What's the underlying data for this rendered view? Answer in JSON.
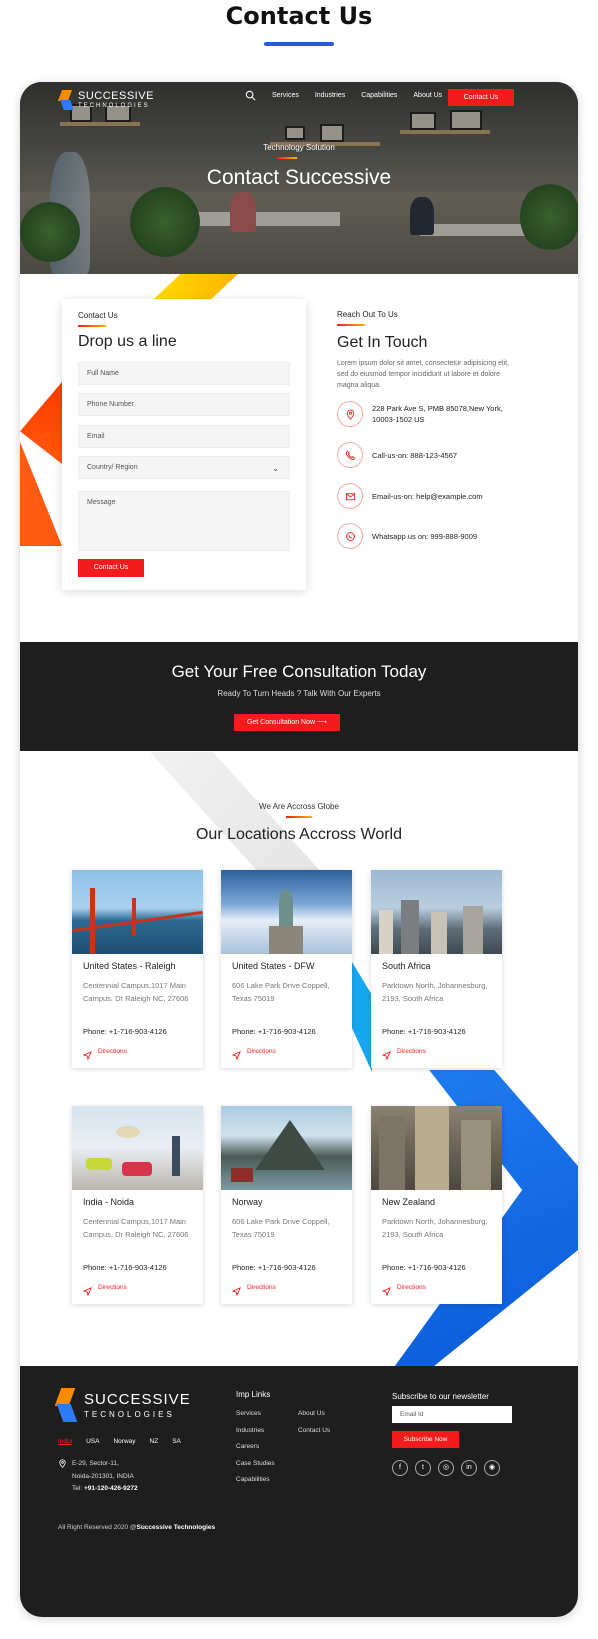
{
  "page_heading": "Contact Us",
  "header": {
    "logo_line1": "SUCCESSIVE",
    "logo_line2": "TECHNOLOGIES",
    "nav": [
      "Services",
      "Industries",
      "Capabilities",
      "About Us"
    ],
    "cta": "Contact Us"
  },
  "hero": {
    "eyebrow": "Technology Solution",
    "title": "Contact Successive"
  },
  "form": {
    "eyebrow": "Contact Us",
    "title": "Drop us a line",
    "full_name_placeholder": "Full Name",
    "phone_placeholder": "Phone Number",
    "email_placeholder": "Email",
    "country_placeholder": "Country/ Region",
    "message_placeholder": "Message",
    "submit": "Contact Us"
  },
  "contact_info": {
    "eyebrow": "Reach Out To Us",
    "title": "Get In Touch",
    "description": "Lorem ipsum dolor sit amet, consectetur adipisicing elit, sed do eiusmod tempor incididunt ut labore et dolore magna aliqua.",
    "address": "228 Park Ave S, PMB 85078,New York, 10003-1502 US",
    "call": "Call-us-on: 888-123-4567",
    "email": "Email-us-on: help@example.com",
    "whatsapp": "Whatsapp us on: 999-888-9009"
  },
  "banner": {
    "title": "Get Your Free Consultation Today",
    "subtitle": "Ready To Turn Heads ? Talk With Our Experts",
    "cta": "Get Consultation Now"
  },
  "locations": {
    "eyebrow": "We Are Accross Globe",
    "title": "Our Locations Accross World",
    "directions_label": "Directions",
    "cards": [
      {
        "name": "United States - Raleigh",
        "address": "Centennial Campus,1017 Main Campus, Dr Raleigh NC, 27606",
        "phone": "Phone: +1-716-903-4126"
      },
      {
        "name": "United States - DFW",
        "address": "606 Lake Park Drive Coppell, Texas 75019",
        "phone": "Phone: +1-716-903-4126"
      },
      {
        "name": "South Africa",
        "address": "Parktown North, Johannesburg, 2193, South Africa",
        "phone": "Phone: +1-716-903-4126"
      },
      {
        "name": "India - Noida",
        "address": "Centennial Campus,1017 Main Campus, Dr Raleigh NC, 27606",
        "phone": "Phone: +1-716-903-4126"
      },
      {
        "name": "Norway",
        "address": "606 Lake Park Drive Coppell, Texas 75019",
        "phone": "Phone: +1-716-903-4126"
      },
      {
        "name": "New Zealand",
        "address": "Parktown North, Johannesburg, 2193, South Africa",
        "phone": "Phone: +1-716-903-4126"
      }
    ]
  },
  "footer": {
    "logo_line1": "SUCCESSIVE",
    "logo_line2": "TECNOLOGIES",
    "countries": [
      "India",
      "USA",
      "Norway",
      "NZ",
      "SA"
    ],
    "address_line1": "E-29, Sector-11,",
    "address_line2": "Noida-201301, INDIA",
    "tel_label": "Tel:",
    "tel_value": "+91-120-426-9272",
    "links_heading": "Imp Links",
    "links_col1": [
      "Services",
      "Industries",
      "Careers",
      "Case Studies",
      "Capabilities"
    ],
    "links_col2": [
      "About Us",
      "Contact Us"
    ],
    "newsletter_heading": "Subscribe to our newsletter",
    "email_placeholder": "Email Id",
    "subscribe": "Subscribe Now",
    "social_icons": [
      "facebook-icon",
      "twitter-icon",
      "instagram-icon",
      "linkedin-icon",
      "dribbble-icon"
    ],
    "copyright_prefix": "All Right Reserved 2020 @",
    "copyright_company": "Successive Technologies"
  },
  "colors": {
    "accent_red": "#f21c1c",
    "dark": "#1e1e1e",
    "blue": "#2a5bd7"
  }
}
